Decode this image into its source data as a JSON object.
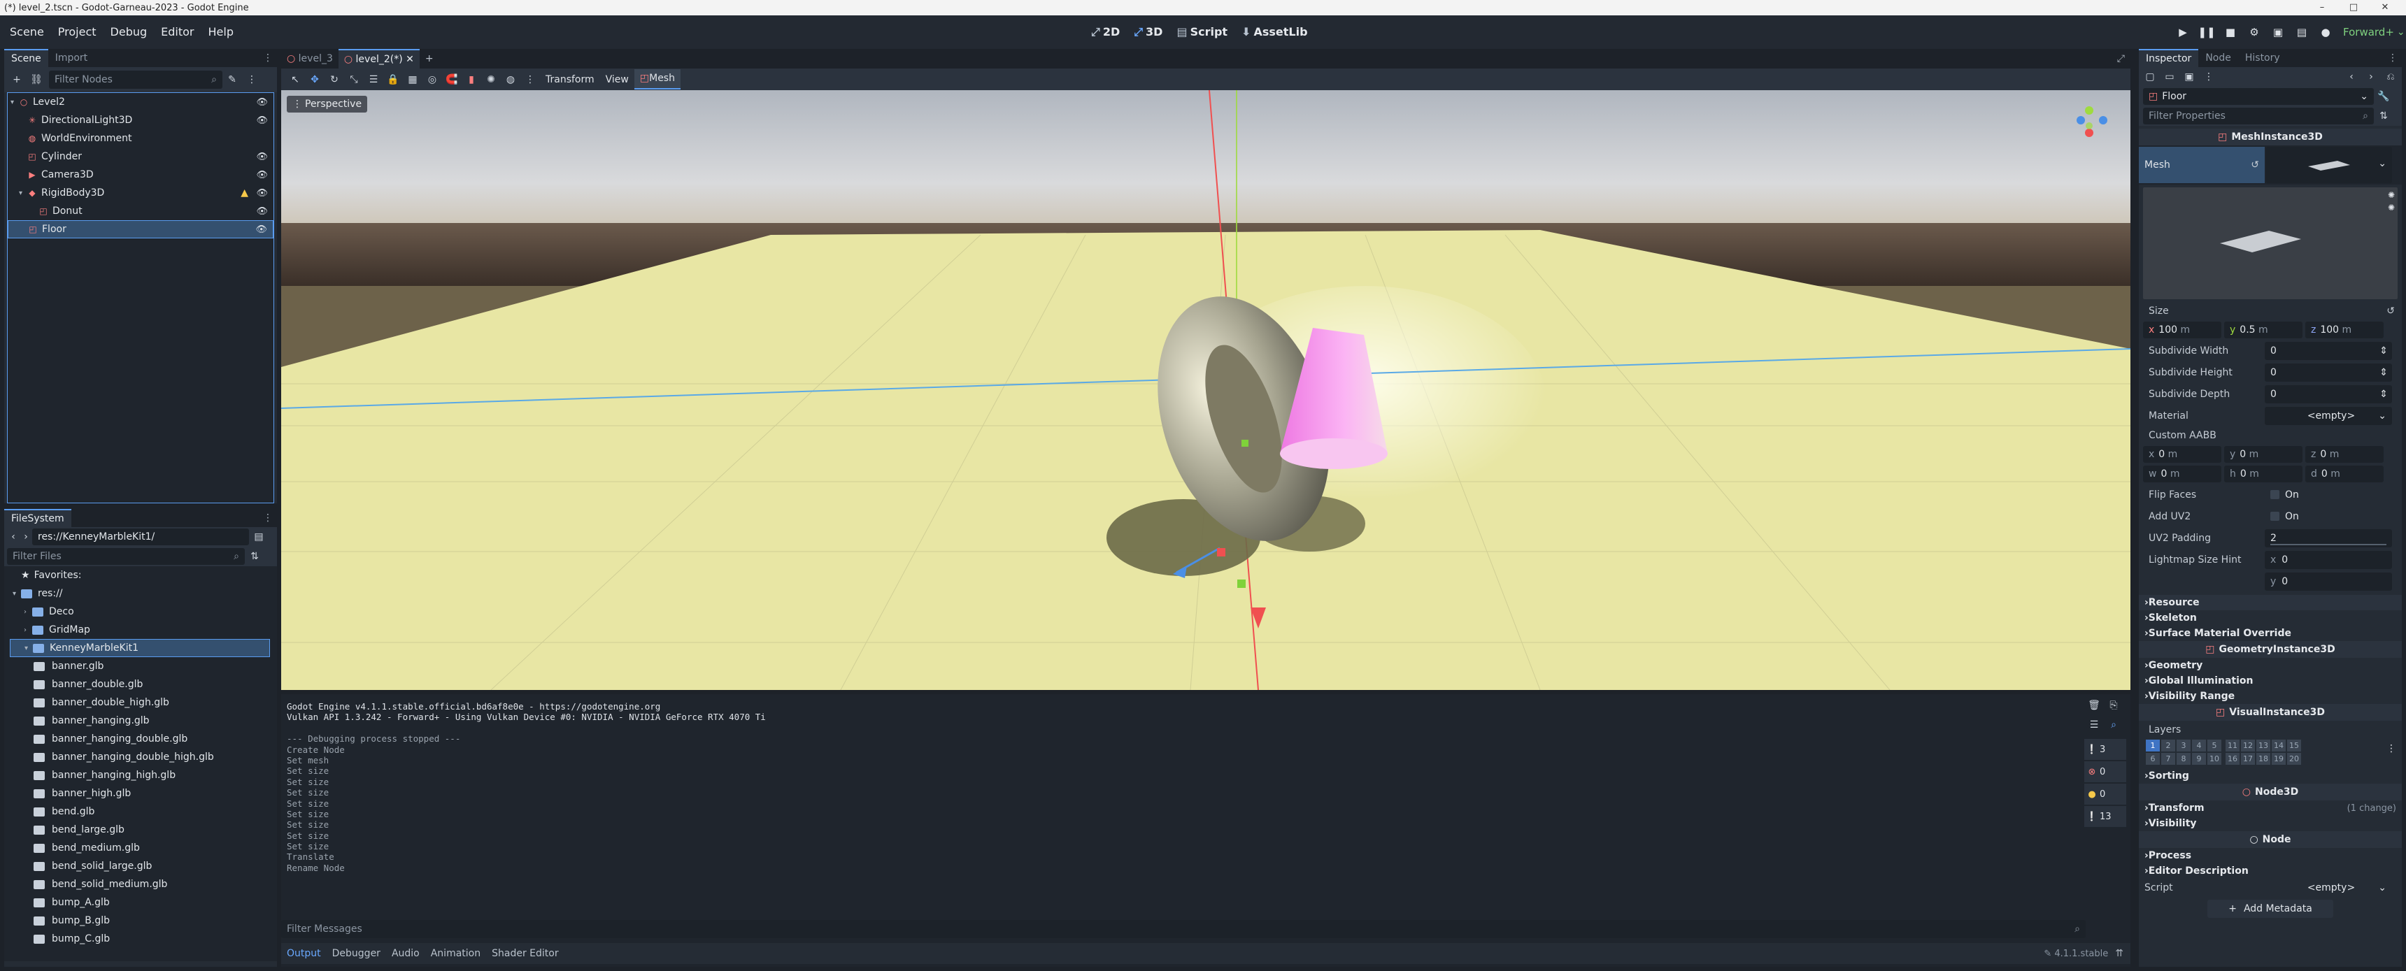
{
  "window": {
    "title": "(*) level_2.tscn - Godot-Garneau-2023 - Godot Engine"
  },
  "menu": {
    "items": [
      "Scene",
      "Project",
      "Debug",
      "Editor",
      "Help"
    ]
  },
  "workspaces": {
    "w2d": "2D",
    "w3d": "3D",
    "script": "Script",
    "assetlib": "AssetLib"
  },
  "renderer": "Forward+",
  "scene_dock": {
    "tabs": [
      "Scene",
      "Import"
    ],
    "filter_placeholder": "Filter Nodes",
    "nodes": [
      {
        "label": "Level2",
        "icon": "node3d-icon"
      },
      {
        "label": "DirectionalLight3D",
        "icon": "light-icon"
      },
      {
        "label": "WorldEnvironment",
        "icon": "world-env-icon"
      },
      {
        "label": "Cylinder",
        "icon": "mesh-icon"
      },
      {
        "label": "Camera3D",
        "icon": "camera-icon"
      },
      {
        "label": "RigidBody3D",
        "icon": "rigidbody-icon"
      },
      {
        "label": "Donut",
        "icon": "mesh-icon"
      },
      {
        "label": "Floor",
        "icon": "mesh-icon"
      }
    ]
  },
  "filesystem": {
    "title": "FileSystem",
    "path": "res://KenneyMarbleKit1/",
    "filter_placeholder": "Filter Files",
    "favorites": "Favorites:",
    "root": "res://",
    "folders": [
      "Deco",
      "GridMap",
      "KenneyMarbleKit1"
    ],
    "files": [
      "banner.glb",
      "banner_double.glb",
      "banner_double_high.glb",
      "banner_hanging.glb",
      "banner_hanging_double.glb",
      "banner_hanging_double_high.glb",
      "banner_hanging_high.glb",
      "banner_high.glb",
      "bend.glb",
      "bend_large.glb",
      "bend_medium.glb",
      "bend_solid_large.glb",
      "bend_solid_medium.glb",
      "bump_A.glb",
      "bump_B.glb",
      "bump_C.glb"
    ]
  },
  "editor_tabs": [
    "level_3",
    "level_2(*)"
  ],
  "viewport_toolbar": {
    "transform": "Transform",
    "view": "View",
    "mesh": "Mesh"
  },
  "viewport": {
    "perspective_label": "Perspective"
  },
  "output": {
    "lines": [
      "Godot Engine v4.1.1.stable.official.bd6af8e0e - https://godotengine.org",
      "Vulkan API 1.3.242 - Forward+ - Using Vulkan Device #0: NVIDIA - NVIDIA GeForce RTX 4070 Ti",
      "",
      "--- Debugging process stopped ---",
      "Create Node",
      "Set mesh",
      "Set size",
      "Set size",
      "Set size",
      "Set size",
      "Set size",
      "Set size",
      "Set size",
      "Set size",
      "Translate",
      "Rename Node"
    ],
    "filter_placeholder": "Filter Messages",
    "counters": {
      "messages": "3",
      "errors": "0",
      "warnings": "0",
      "info": "13"
    },
    "bottom_tabs": [
      "Output",
      "Debugger",
      "Audio",
      "Animation",
      "Shader Editor"
    ],
    "version": "4.1.1.stable"
  },
  "inspector": {
    "tabs": [
      "Inspector",
      "Node",
      "History"
    ],
    "object_name": "Floor",
    "filter_placeholder": "Filter Properties",
    "class_mesh_instance": "MeshInstance3D",
    "mesh_label": "Mesh",
    "size_label": "Size",
    "size": {
      "x": "100",
      "y": "0.5",
      "z": "100",
      "unit": "m"
    },
    "props": [
      {
        "label": "Subdivide Width",
        "value": "0"
      },
      {
        "label": "Subdivide Height",
        "value": "0"
      },
      {
        "label": "Subdivide Depth",
        "value": "0"
      }
    ],
    "material_label": "Material",
    "material_value": "<empty>",
    "custom_aabb_label": "Custom AABB",
    "aabb": {
      "x": "0",
      "y": "0",
      "z": "0",
      "w": "0",
      "h": "0",
      "d": "0",
      "unit": "m"
    },
    "flip_faces_label": "Flip Faces",
    "flip_faces_value": "On",
    "add_uv2_label": "Add UV2",
    "add_uv2_value": "On",
    "uv2_padding_label": "UV2 Padding",
    "uv2_padding_value": "2",
    "lightmap_label": "Lightmap Size Hint",
    "lightmap_x": "0",
    "lightmap_y": "0",
    "sections_mesh": [
      "Resource",
      "Skeleton",
      "Surface Material Override"
    ],
    "class_geometry": "GeometryInstance3D",
    "sections_geometry": [
      "Geometry",
      "Global Illumination",
      "Visibility Range"
    ],
    "class_visual": "VisualInstance3D",
    "layers_label": "Layers",
    "layers_row1": [
      "1",
      "2",
      "3",
      "4",
      "5",
      "11",
      "12",
      "13",
      "14",
      "15"
    ],
    "layers_row2": [
      "6",
      "7",
      "8",
      "9",
      "10",
      "16",
      "17",
      "18",
      "19",
      "20"
    ],
    "sections_visual": [
      "Sorting"
    ],
    "class_node3d": "Node3D",
    "transform_label": "Transform",
    "transform_change": "(1 change)",
    "visibility_label": "Visibility",
    "class_node": "Node",
    "sections_node": [
      "Process",
      "Editor Description"
    ],
    "script_label": "Script",
    "script_value": "<empty>",
    "add_metadata": "Add Metadata"
  },
  "colors": {
    "accent": "#5a9cf0",
    "floor": "#e8e6a4",
    "selection": "#34506f"
  }
}
